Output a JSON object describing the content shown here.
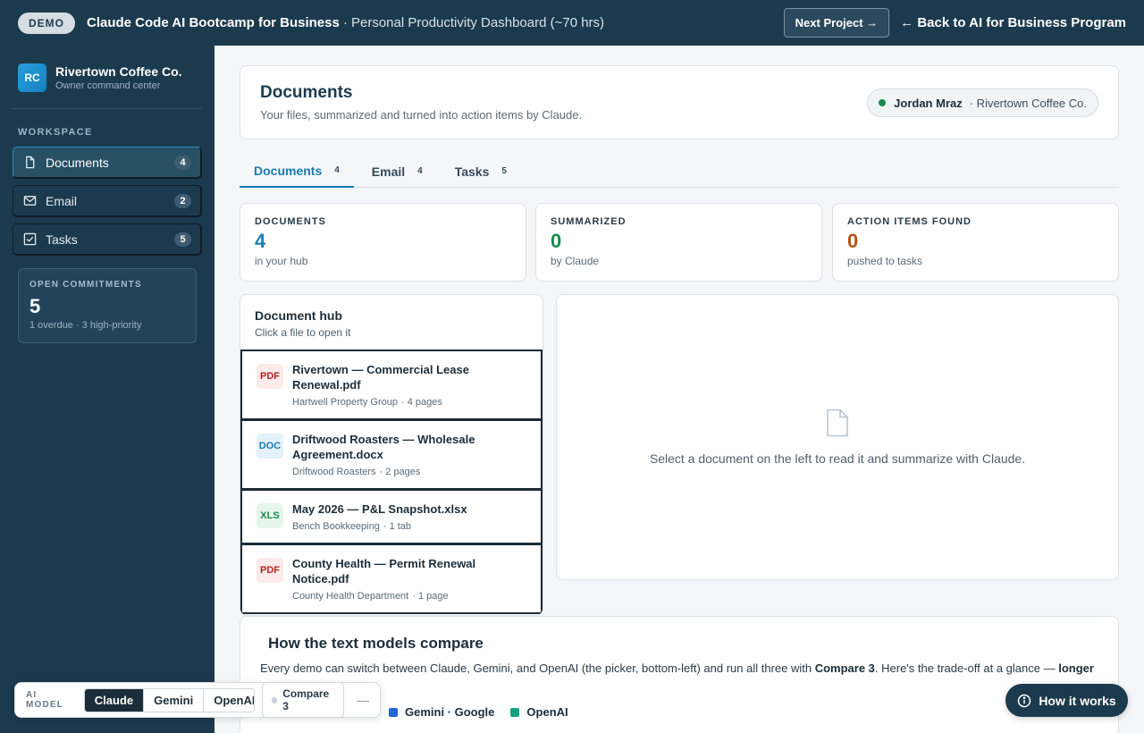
{
  "topbar": {
    "demo": "DEMO",
    "title": "Claude Code AI Bootcamp for Business",
    "subtitle": "· Personal Productivity Dashboard (~70 hrs)",
    "next_label": "Next Project →",
    "back_label": "← Back to AI for Business Program"
  },
  "brand": {
    "logo": "RC",
    "name": "Rivertown Coffee Co.",
    "sub": "Owner command center"
  },
  "sidebar": {
    "section_label": "WORKSPACE",
    "items": [
      {
        "label": "Documents",
        "count": "4",
        "icon": "document-icon"
      },
      {
        "label": "Email",
        "count": "2",
        "icon": "mail-icon"
      },
      {
        "label": "Tasks",
        "count": "5",
        "icon": "checkbox-icon"
      }
    ],
    "commitments": {
      "label": "OPEN COMMITMENTS",
      "value": "5",
      "sub": "1 overdue · 3 high-priority"
    }
  },
  "header": {
    "title": "Documents",
    "subtitle": "Your files, summarized and turned into action items by Claude.",
    "user_name": "Jordan Mraz",
    "user_org": "· Rivertown Coffee Co."
  },
  "tabs": [
    {
      "label": "Documents",
      "count": "4"
    },
    {
      "label": "Email",
      "count": "4"
    },
    {
      "label": "Tasks",
      "count": "5"
    }
  ],
  "stats": [
    {
      "label": "DOCUMENTS",
      "value": "4",
      "sub": "in your hub",
      "color": "#1b7bb0"
    },
    {
      "label": "SUMMARIZED",
      "value": "0",
      "sub": "by Claude",
      "color": "#188a4a"
    },
    {
      "label": "ACTION ITEMS FOUND",
      "value": "0",
      "sub": "pushed to tasks",
      "color": "#b5520f"
    }
  ],
  "hub": {
    "title": "Document hub",
    "sub": "Click a file to open it",
    "docs": [
      {
        "type": "PDF",
        "name": "Rivertown — Commercial Lease Renewal.pdf",
        "source": "Hartwell Property Group",
        "pages": "· 4 pages"
      },
      {
        "type": "DOC",
        "name": "Driftwood Roasters — Wholesale Agreement.docx",
        "source": "Driftwood Roasters",
        "pages": "· 2 pages"
      },
      {
        "type": "XLS",
        "name": "May 2026 — P&L Snapshot.xlsx",
        "source": "Bench Bookkeeping",
        "pages": "· 1 tab"
      },
      {
        "type": "PDF",
        "name": "County Health — Permit Renewal Notice.pdf",
        "source": "County Health Department",
        "pages": "· 1 page"
      }
    ]
  },
  "viewer": {
    "empty_text": "Select a document on the left to read it and summarize with Claude."
  },
  "compare": {
    "title": "How the text models compare",
    "text_a": "Every demo can switch between Claude, Gemini, and OpenAI (the picker, bottom-left) and run all three with ",
    "text_b": "Compare 3",
    "text_c": ". Here's the trade-off at a glance — ",
    "text_d": "longer",
    "legend": [
      {
        "label": "Gemini · Google",
        "color": "#2563d8"
      },
      {
        "label": "OpenAI",
        "color": "#14a37f"
      }
    ]
  },
  "picker": {
    "label": "AI MODEL",
    "options": [
      "Claude",
      "Gemini",
      "OpenAI"
    ],
    "selected": "Claude",
    "compare_label": "Compare 3",
    "minimize": "—"
  },
  "how_it_works": "How it works"
}
